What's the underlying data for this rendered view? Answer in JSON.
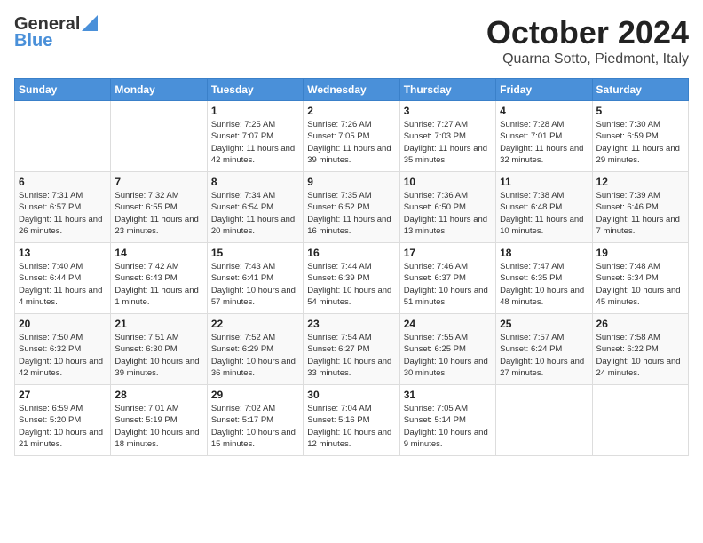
{
  "logo": {
    "line1": "General",
    "line2": "Blue"
  },
  "title": "October 2024",
  "subtitle": "Quarna Sotto, Piedmont, Italy",
  "days_of_week": [
    "Sunday",
    "Monday",
    "Tuesday",
    "Wednesday",
    "Thursday",
    "Friday",
    "Saturday"
  ],
  "weeks": [
    [
      {
        "day": "",
        "sunrise": "",
        "sunset": "",
        "daylight": ""
      },
      {
        "day": "",
        "sunrise": "",
        "sunset": "",
        "daylight": ""
      },
      {
        "day": "1",
        "sunrise": "Sunrise: 7:25 AM",
        "sunset": "Sunset: 7:07 PM",
        "daylight": "Daylight: 11 hours and 42 minutes."
      },
      {
        "day": "2",
        "sunrise": "Sunrise: 7:26 AM",
        "sunset": "Sunset: 7:05 PM",
        "daylight": "Daylight: 11 hours and 39 minutes."
      },
      {
        "day": "3",
        "sunrise": "Sunrise: 7:27 AM",
        "sunset": "Sunset: 7:03 PM",
        "daylight": "Daylight: 11 hours and 35 minutes."
      },
      {
        "day": "4",
        "sunrise": "Sunrise: 7:28 AM",
        "sunset": "Sunset: 7:01 PM",
        "daylight": "Daylight: 11 hours and 32 minutes."
      },
      {
        "day": "5",
        "sunrise": "Sunrise: 7:30 AM",
        "sunset": "Sunset: 6:59 PM",
        "daylight": "Daylight: 11 hours and 29 minutes."
      }
    ],
    [
      {
        "day": "6",
        "sunrise": "Sunrise: 7:31 AM",
        "sunset": "Sunset: 6:57 PM",
        "daylight": "Daylight: 11 hours and 26 minutes."
      },
      {
        "day": "7",
        "sunrise": "Sunrise: 7:32 AM",
        "sunset": "Sunset: 6:55 PM",
        "daylight": "Daylight: 11 hours and 23 minutes."
      },
      {
        "day": "8",
        "sunrise": "Sunrise: 7:34 AM",
        "sunset": "Sunset: 6:54 PM",
        "daylight": "Daylight: 11 hours and 20 minutes."
      },
      {
        "day": "9",
        "sunrise": "Sunrise: 7:35 AM",
        "sunset": "Sunset: 6:52 PM",
        "daylight": "Daylight: 11 hours and 16 minutes."
      },
      {
        "day": "10",
        "sunrise": "Sunrise: 7:36 AM",
        "sunset": "Sunset: 6:50 PM",
        "daylight": "Daylight: 11 hours and 13 minutes."
      },
      {
        "day": "11",
        "sunrise": "Sunrise: 7:38 AM",
        "sunset": "Sunset: 6:48 PM",
        "daylight": "Daylight: 11 hours and 10 minutes."
      },
      {
        "day": "12",
        "sunrise": "Sunrise: 7:39 AM",
        "sunset": "Sunset: 6:46 PM",
        "daylight": "Daylight: 11 hours and 7 minutes."
      }
    ],
    [
      {
        "day": "13",
        "sunrise": "Sunrise: 7:40 AM",
        "sunset": "Sunset: 6:44 PM",
        "daylight": "Daylight: 11 hours and 4 minutes."
      },
      {
        "day": "14",
        "sunrise": "Sunrise: 7:42 AM",
        "sunset": "Sunset: 6:43 PM",
        "daylight": "Daylight: 11 hours and 1 minute."
      },
      {
        "day": "15",
        "sunrise": "Sunrise: 7:43 AM",
        "sunset": "Sunset: 6:41 PM",
        "daylight": "Daylight: 10 hours and 57 minutes."
      },
      {
        "day": "16",
        "sunrise": "Sunrise: 7:44 AM",
        "sunset": "Sunset: 6:39 PM",
        "daylight": "Daylight: 10 hours and 54 minutes."
      },
      {
        "day": "17",
        "sunrise": "Sunrise: 7:46 AM",
        "sunset": "Sunset: 6:37 PM",
        "daylight": "Daylight: 10 hours and 51 minutes."
      },
      {
        "day": "18",
        "sunrise": "Sunrise: 7:47 AM",
        "sunset": "Sunset: 6:35 PM",
        "daylight": "Daylight: 10 hours and 48 minutes."
      },
      {
        "day": "19",
        "sunrise": "Sunrise: 7:48 AM",
        "sunset": "Sunset: 6:34 PM",
        "daylight": "Daylight: 10 hours and 45 minutes."
      }
    ],
    [
      {
        "day": "20",
        "sunrise": "Sunrise: 7:50 AM",
        "sunset": "Sunset: 6:32 PM",
        "daylight": "Daylight: 10 hours and 42 minutes."
      },
      {
        "day": "21",
        "sunrise": "Sunrise: 7:51 AM",
        "sunset": "Sunset: 6:30 PM",
        "daylight": "Daylight: 10 hours and 39 minutes."
      },
      {
        "day": "22",
        "sunrise": "Sunrise: 7:52 AM",
        "sunset": "Sunset: 6:29 PM",
        "daylight": "Daylight: 10 hours and 36 minutes."
      },
      {
        "day": "23",
        "sunrise": "Sunrise: 7:54 AM",
        "sunset": "Sunset: 6:27 PM",
        "daylight": "Daylight: 10 hours and 33 minutes."
      },
      {
        "day": "24",
        "sunrise": "Sunrise: 7:55 AM",
        "sunset": "Sunset: 6:25 PM",
        "daylight": "Daylight: 10 hours and 30 minutes."
      },
      {
        "day": "25",
        "sunrise": "Sunrise: 7:57 AM",
        "sunset": "Sunset: 6:24 PM",
        "daylight": "Daylight: 10 hours and 27 minutes."
      },
      {
        "day": "26",
        "sunrise": "Sunrise: 7:58 AM",
        "sunset": "Sunset: 6:22 PM",
        "daylight": "Daylight: 10 hours and 24 minutes."
      }
    ],
    [
      {
        "day": "27",
        "sunrise": "Sunrise: 6:59 AM",
        "sunset": "Sunset: 5:20 PM",
        "daylight": "Daylight: 10 hours and 21 minutes."
      },
      {
        "day": "28",
        "sunrise": "Sunrise: 7:01 AM",
        "sunset": "Sunset: 5:19 PM",
        "daylight": "Daylight: 10 hours and 18 minutes."
      },
      {
        "day": "29",
        "sunrise": "Sunrise: 7:02 AM",
        "sunset": "Sunset: 5:17 PM",
        "daylight": "Daylight: 10 hours and 15 minutes."
      },
      {
        "day": "30",
        "sunrise": "Sunrise: 7:04 AM",
        "sunset": "Sunset: 5:16 PM",
        "daylight": "Daylight: 10 hours and 12 minutes."
      },
      {
        "day": "31",
        "sunrise": "Sunrise: 7:05 AM",
        "sunset": "Sunset: 5:14 PM",
        "daylight": "Daylight: 10 hours and 9 minutes."
      },
      {
        "day": "",
        "sunrise": "",
        "sunset": "",
        "daylight": ""
      },
      {
        "day": "",
        "sunrise": "",
        "sunset": "",
        "daylight": ""
      }
    ]
  ]
}
